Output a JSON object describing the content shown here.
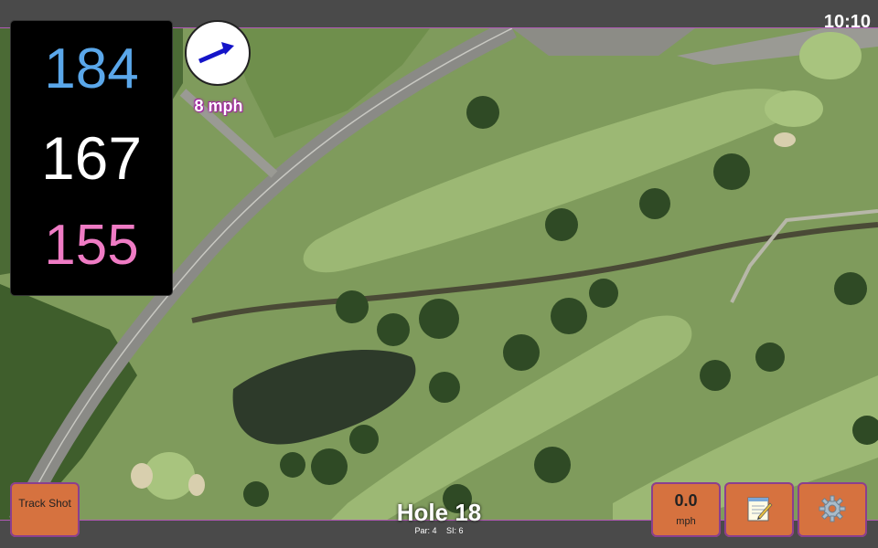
{
  "status_bar": {
    "time": "10:10"
  },
  "distances": {
    "back": "184",
    "middle": "167",
    "front": "155"
  },
  "wind": {
    "speed": "8 mph",
    "arrow_icon": "wind-direction-arrow-icon"
  },
  "buttons": {
    "track_shot": "Track Shot",
    "speed_value": "0.0",
    "speed_unit": "mph",
    "notes_icon": "notepad-icon",
    "settings_icon": "gear-icon"
  },
  "hole": {
    "title": "Hole 18",
    "par": "Par: 4",
    "si": "SI: 6"
  },
  "colors": {
    "back_distance": "#5aa7ea",
    "middle_distance": "#ffffff",
    "front_distance": "#ef7bc4",
    "button": "#d6723f",
    "accent": "#b25ab7"
  }
}
